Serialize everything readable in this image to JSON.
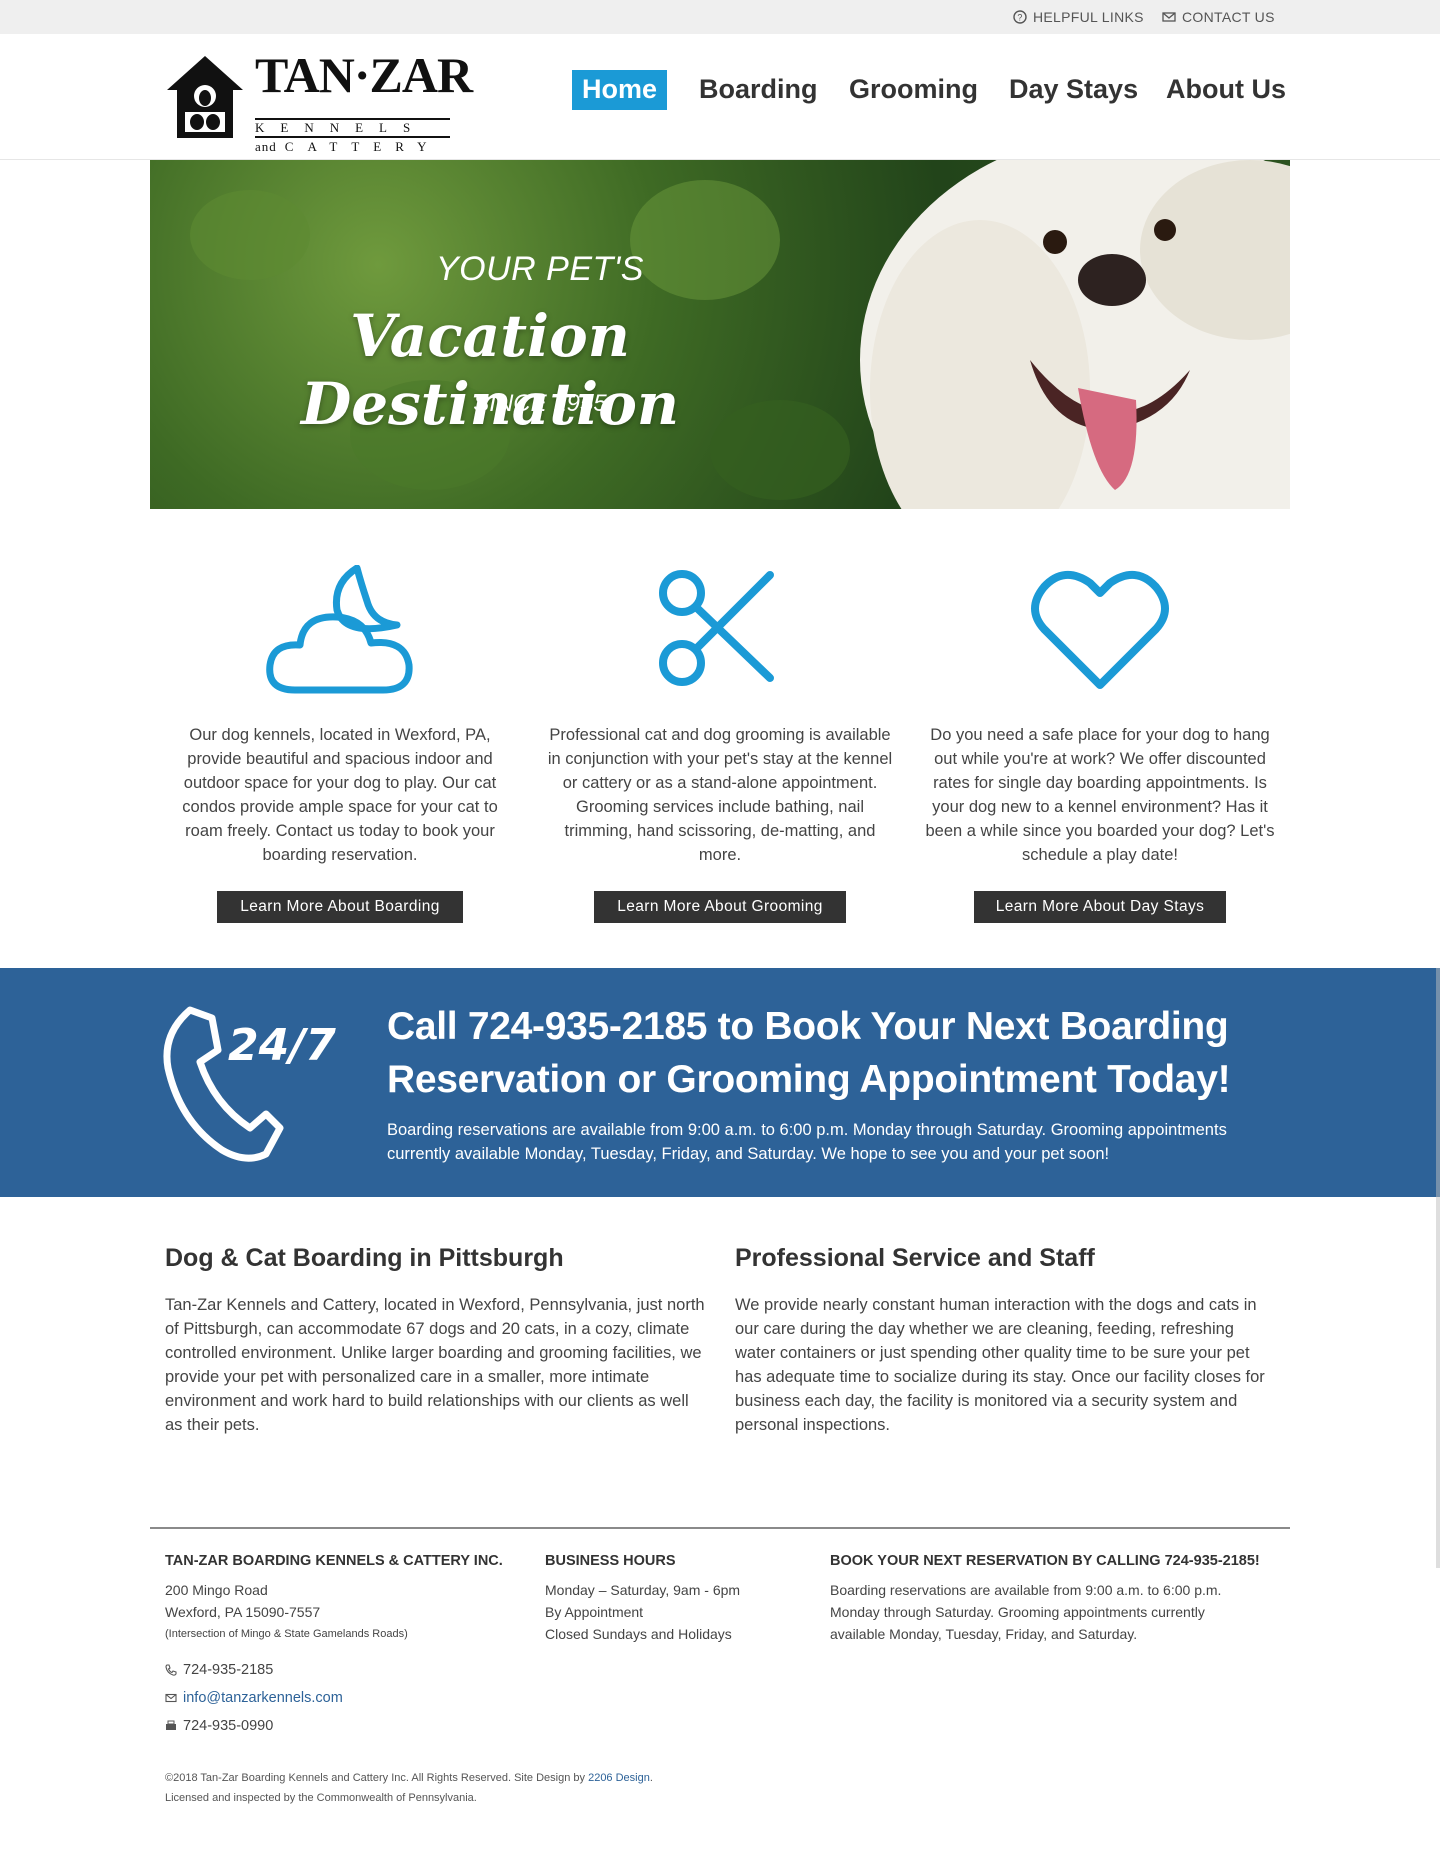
{
  "utility": {
    "helpful_links": "Helpful Links",
    "contact_us": "Contact Us"
  },
  "logo": {
    "title": "TAN·ZAR",
    "line1": "KENNELS",
    "line2_prefix": "and",
    "line2": "CATTERY"
  },
  "nav": {
    "items": [
      "Home",
      "Boarding",
      "Grooming",
      "Day Stays",
      "About Us"
    ],
    "active": "Home"
  },
  "hero": {
    "kicker": "YOUR PET'S",
    "title": "Vacation Destination",
    "since": "SINCE 1955"
  },
  "features": [
    {
      "icon": "cloud-moon-icon",
      "text": "Our dog kennels, located in Wexford, PA, provide beautiful and spacious indoor and outdoor space for your dog to play. Our cat condos provide ample space for your cat to roam freely. Contact us today to book your boarding reservation.",
      "button": "Learn More About Boarding"
    },
    {
      "icon": "scissors-icon",
      "text": "Professional cat and dog grooming is available in conjunction with your pet's stay at the kennel or cattery or as a stand-alone appointment. Grooming services include bathing, nail trimming, hand scissoring, de-matting, and more.",
      "button": "Learn More About Grooming"
    },
    {
      "icon": "heart-icon",
      "text": "Do you need a safe place for your dog to hang out while you're at work? We offer discounted rates for single day boarding appointments. Is your dog new to a kennel environment? Has it been a while since you boarded your dog? Let's schedule a play date!",
      "button": "Learn More About Day Stays"
    }
  ],
  "callband": {
    "badge": "24/7",
    "title": "Call 724-935-2185 to Book Your Next Boarding Reservation or Grooming Appointment Today!",
    "text": "Boarding reservations are available from 9:00 a.m. to 6:00 p.m. Monday through Saturday. Grooming appointments currently available Monday, Tuesday, Friday, and Saturday. We hope to see you and your pet soon!"
  },
  "content": {
    "left": {
      "title": "Dog & Cat Boarding in Pittsburgh",
      "text": "Tan-Zar Kennels and Cattery, located in Wexford, Pennsylvania, just north of Pittsburgh, can accommodate 67 dogs and 20 cats, in a cozy, climate controlled environment. Unlike larger boarding and grooming facilities, we provide your pet with personalized care in a smaller, more intimate environment and work hard to build relationships with our clients as well as their pets."
    },
    "right": {
      "title": "Professional Service and Staff",
      "text": "We provide nearly constant human interaction with the dogs and cats in our care during the day whether we are cleaning, feeding, refreshing water containers or just spending other quality time to be sure your pet has adequate time to socialize during its stay. Once our facility closes for business each day, the facility is monitored via a security system and personal inspections."
    }
  },
  "footer": {
    "company": {
      "heading": "TAN-ZAR BOARDING KENNELS & CATTERY INC.",
      "address1": "200 Mingo Road",
      "address2": "Wexford, PA 15090-7557",
      "address_note": "(Intersection of Mingo & State Gamelands Roads)",
      "phone": "724-935-2185",
      "email": "info@tanzarkennels.com",
      "fax": "724-935-0990"
    },
    "hours": {
      "heading": "BUSINESS HOURS",
      "line1": "Monday – Saturday, 9am - 6pm",
      "line2": "By Appointment",
      "line3": "Closed Sundays and Holidays"
    },
    "book": {
      "heading": "BOOK YOUR NEXT RESERVATION BY CALLING 724-935-2185!",
      "text": "Boarding reservations are available from 9:00 a.m. to 6:00 p.m. Monday through Saturday. Grooming appointments currently available Monday, Tuesday, Friday, and Saturday."
    },
    "copyright": "©2018 Tan-Zar Boarding Kennels and Cattery Inc. All Rights Reserved. Site Design by",
    "designer": "2206 Design",
    "license": "Licensed and inspected by the Commonwealth of Pennsylvania."
  },
  "colors": {
    "accent": "#1b9ad6",
    "band": "#2d6298",
    "button": "#333333"
  }
}
